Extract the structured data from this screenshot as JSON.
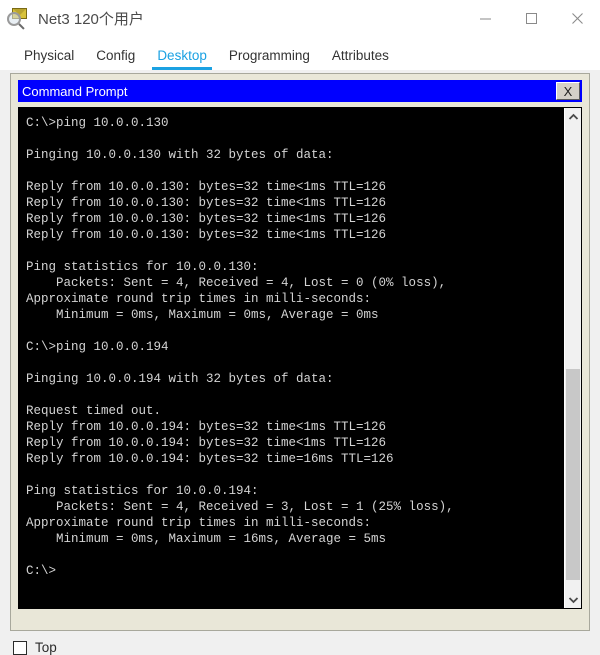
{
  "window": {
    "title": "Net3 120个用户",
    "icon": "packet-tracer-icon",
    "controls": {
      "minimize": "—",
      "maximize": "□",
      "close": "✕"
    }
  },
  "tabs": [
    {
      "label": "Physical",
      "active": false
    },
    {
      "label": "Config",
      "active": false
    },
    {
      "label": "Desktop",
      "active": true
    },
    {
      "label": "Programming",
      "active": false
    },
    {
      "label": "Attributes",
      "active": false
    }
  ],
  "command_prompt": {
    "title": "Command Prompt",
    "close_label": "X",
    "titlebar_color": "#0000ff",
    "terminal_bg": "#000000",
    "terminal_fg": "#d4d4d4",
    "output": "C:\\>ping 10.0.0.130\n\nPinging 10.0.0.130 with 32 bytes of data:\n\nReply from 10.0.0.130: bytes=32 time<1ms TTL=126\nReply from 10.0.0.130: bytes=32 time<1ms TTL=126\nReply from 10.0.0.130: bytes=32 time<1ms TTL=126\nReply from 10.0.0.130: bytes=32 time<1ms TTL=126\n\nPing statistics for 10.0.0.130:\n    Packets: Sent = 4, Received = 4, Lost = 0 (0% loss),\nApproximate round trip times in milli-seconds:\n    Minimum = 0ms, Maximum = 0ms, Average = 0ms\n\nC:\\>ping 10.0.0.194\n\nPinging 10.0.0.194 with 32 bytes of data:\n\nRequest timed out.\nReply from 10.0.0.194: bytes=32 time<1ms TTL=126\nReply from 10.0.0.194: bytes=32 time<1ms TTL=126\nReply from 10.0.0.194: bytes=32 time=16ms TTL=126\n\nPing statistics for 10.0.0.194:\n    Packets: Sent = 4, Received = 3, Lost = 1 (25% loss),\nApproximate round trip times in milli-seconds:\n    Minimum = 0ms, Maximum = 16ms, Average = 5ms\n\nC:\\>"
  },
  "footer": {
    "top_checkbox_label": "Top",
    "top_checkbox_checked": false
  }
}
